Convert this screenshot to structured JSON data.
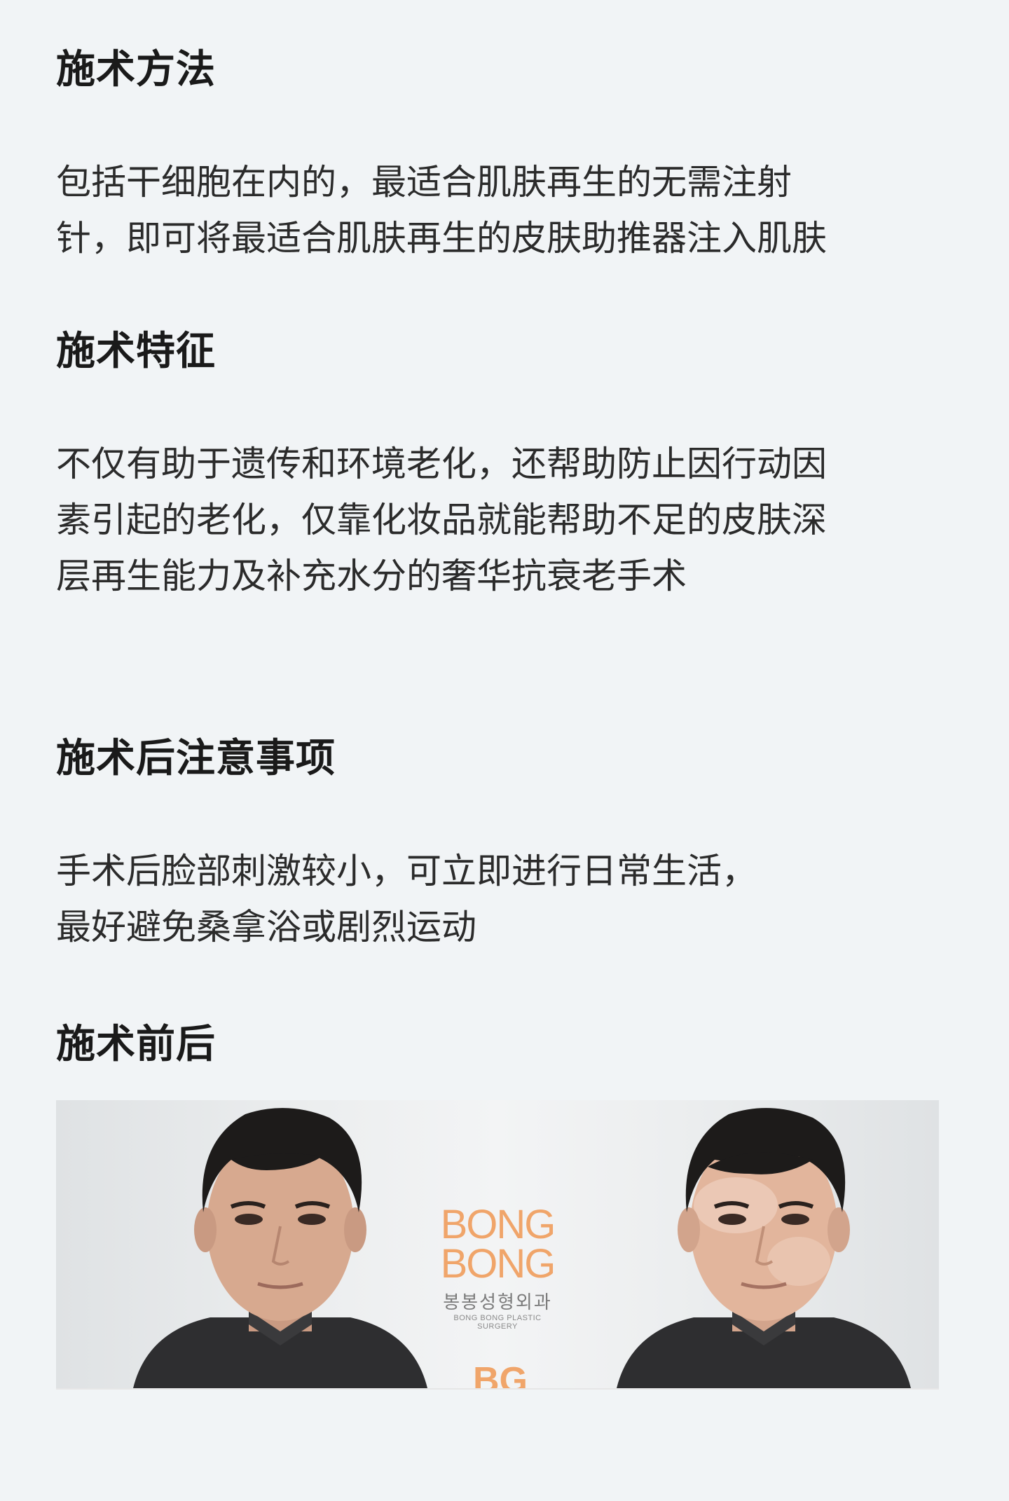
{
  "sections": {
    "method": {
      "title": "施术方法",
      "lines": [
        "包括干细胞在内的，最适合肌肤再生的无需注射",
        "针，即可将最适合肌肤再生的皮肤助推器注入肌肤"
      ]
    },
    "features": {
      "title": "施术特征",
      "lines": [
        "不仅有助于遗传和环境老化，还帮助防止因行动因",
        "素引起的老化，仅靠化妆品就能帮助不足的皮肤深",
        "层再生能力及补充水分的奢华抗衰老手术"
      ]
    },
    "aftercare": {
      "title": "施术后注意事项",
      "lines": [
        "手术后脸部刺激较小，可立即进行日常生活，",
        "最好避免桑拿浴或剧烈运动"
      ]
    },
    "before_after": {
      "title": "施术前后"
    }
  },
  "image": {
    "logo_line1": "BONG",
    "logo_line2": "BONG",
    "logo_korean": "봉봉성형외과",
    "logo_english": "BONG BONG PLASTIC SURGERY",
    "logo_mark": "BG",
    "accent_color": "#f0a56a"
  }
}
